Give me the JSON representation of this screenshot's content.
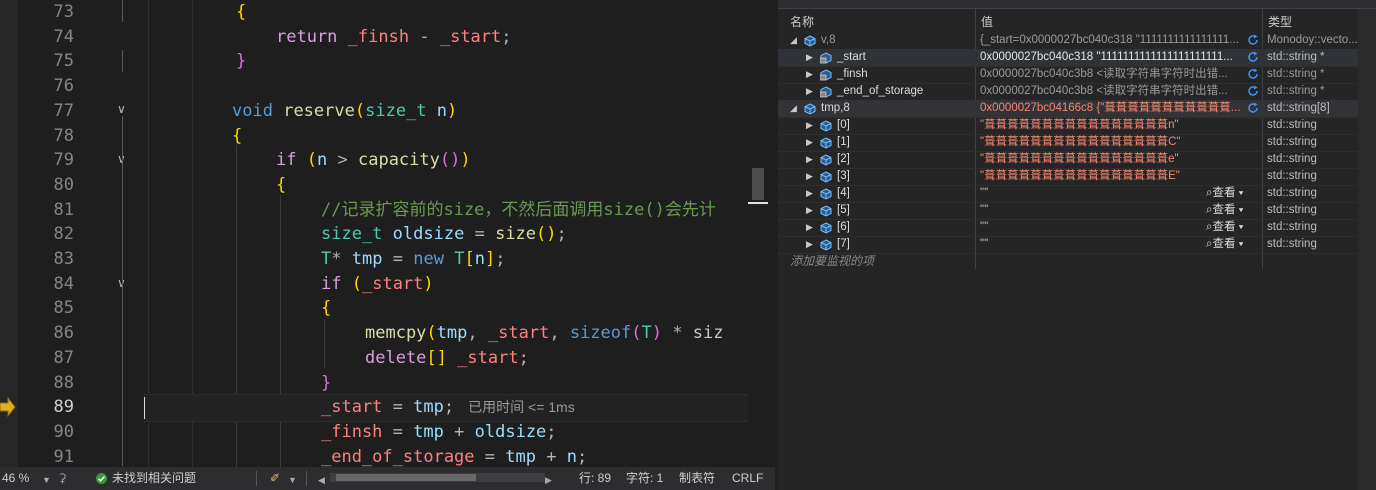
{
  "editor": {
    "lines": [
      {
        "num": "73",
        "text": "{"
      },
      {
        "num": "74",
        "text": "return _finsh - _start;"
      },
      {
        "num": "75",
        "text": "}"
      },
      {
        "num": "76",
        "text": ""
      },
      {
        "num": "77",
        "text": "void reserve(size_t n)"
      },
      {
        "num": "78",
        "text": "{"
      },
      {
        "num": "79",
        "text": "if (n > capacity())"
      },
      {
        "num": "80",
        "text": "{"
      },
      {
        "num": "81",
        "text": "//记录扩容前的size，不然后面调用size()会先计"
      },
      {
        "num": "82",
        "text": "size_t oldsize = size();"
      },
      {
        "num": "83",
        "text": "T* tmp = new T[n];"
      },
      {
        "num": "84",
        "text": "if (_start)"
      },
      {
        "num": "85",
        "text": "{"
      },
      {
        "num": "86",
        "text": "memcpy(tmp, _start, sizeof(T) * siz"
      },
      {
        "num": "87",
        "text": "delete[] _start;"
      },
      {
        "num": "88",
        "text": "}"
      },
      {
        "num": "89",
        "text": "_start = tmp;"
      },
      {
        "num": "90",
        "text": "_finsh = tmp + oldsize;"
      },
      {
        "num": "91",
        "text": "_end_of_storage = tmp + n;"
      }
    ],
    "elapsed_hint": "已用时间 <= 1ms"
  },
  "statusbar": {
    "zoom": "46 %",
    "issues": "未找到相关问题",
    "line": "行: 89",
    "char": "字符: 1",
    "indent": "制表符",
    "eol": "CRLF"
  },
  "watch": {
    "columns": {
      "name": "名称",
      "value": "值",
      "type": "类型"
    },
    "rows": [
      {
        "name": "v,8",
        "value": "{_start=0x0000027bc040c318 \"1111111111111111...",
        "type": "Monodoy::vecto..."
      },
      {
        "name": "_start",
        "value": "0x0000027bc040c318 \"1111111111111111111111...",
        "type": "std::string *"
      },
      {
        "name": "_finsh",
        "value": "0x0000027bc040c3b8 <读取字符串字符时出错...",
        "type": "std::string *"
      },
      {
        "name": "_end_of_storage",
        "value": "0x0000027bc040c3b8 <读取字符串字符时出错...",
        "type": "std::string *"
      },
      {
        "name": "tmp,8",
        "value": "0x0000027bc04166c8 {\"葺葺葺葺葺葺葺葺葺葺葺...",
        "type": "std::string[8]"
      },
      {
        "name": "[0]",
        "value": "\"葺葺葺葺葺葺葺葺葺葺葺葺葺葺葺葺n\"",
        "type": "std::string"
      },
      {
        "name": "[1]",
        "value": "\"葺葺葺葺葺葺葺葺葺葺葺葺葺葺葺葺C\"",
        "type": "std::string"
      },
      {
        "name": "[2]",
        "value": "\"葺葺葺葺葺葺葺葺葺葺葺葺葺葺葺葺e\"",
        "type": "std::string"
      },
      {
        "name": "[3]",
        "value": "\"葺葺葺葺葺葺葺葺葺葺葺葺葺葺葺葺E\"",
        "type": "std::string"
      },
      {
        "name": "[4]",
        "value": "\"\"",
        "type": "std::string"
      },
      {
        "name": "[5]",
        "value": "\"\"",
        "type": "std::string"
      },
      {
        "name": "[6]",
        "value": "\"\"",
        "type": "std::string"
      },
      {
        "name": "[7]",
        "value": "\"\"",
        "type": "std::string"
      }
    ],
    "view_label": "查看",
    "add_watch": "添加要监视的项"
  }
}
